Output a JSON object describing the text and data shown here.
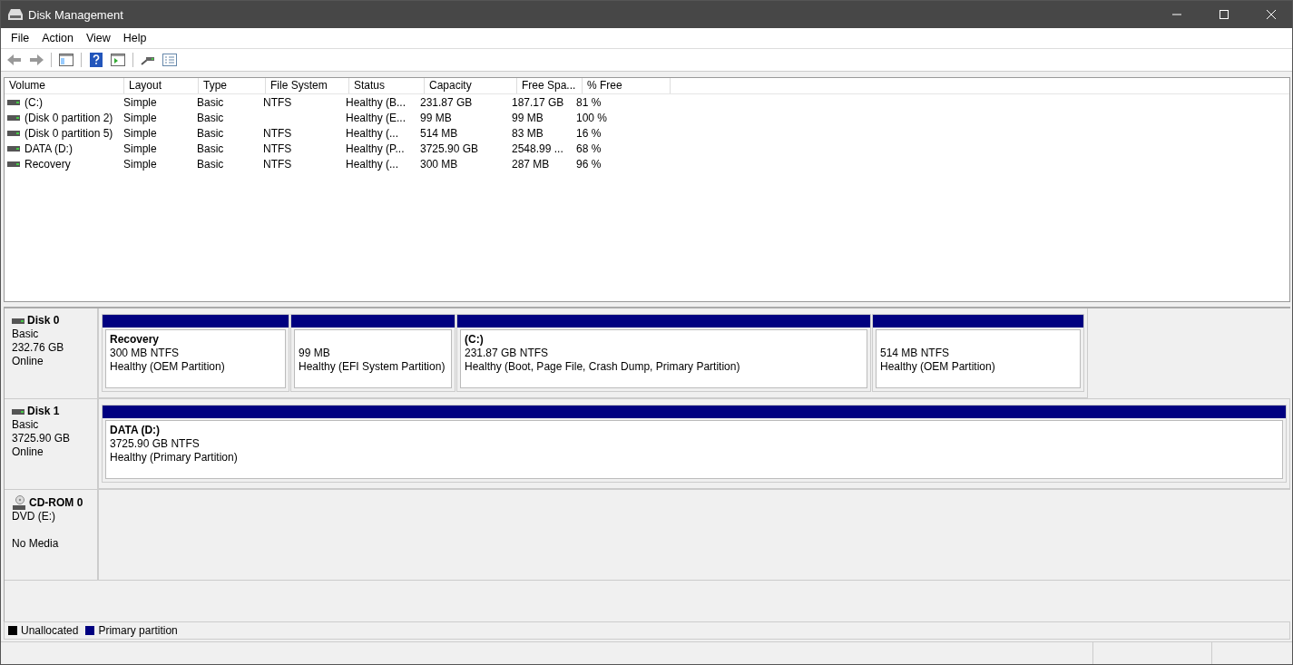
{
  "window": {
    "title": "Disk Management"
  },
  "menu": [
    "File",
    "Action",
    "View",
    "Help"
  ],
  "table": {
    "columns": [
      "Volume",
      "Layout",
      "Type",
      "File System",
      "Status",
      "Capacity",
      "Free Spa...",
      "% Free"
    ],
    "rows": [
      [
        "(C:)",
        "Simple",
        "Basic",
        "NTFS",
        "Healthy (B...",
        "231.87 GB",
        "187.17 GB",
        "81 %"
      ],
      [
        "(Disk 0 partition 2)",
        "Simple",
        "Basic",
        "",
        "Healthy (E...",
        "99 MB",
        "99 MB",
        "100 %"
      ],
      [
        "(Disk 0 partition 5)",
        "Simple",
        "Basic",
        "NTFS",
        "Healthy (...",
        "514 MB",
        "83 MB",
        "16 %"
      ],
      [
        "DATA (D:)",
        "Simple",
        "Basic",
        "NTFS",
        "Healthy (P...",
        "3725.90 GB",
        "2548.99 ...",
        "68 %"
      ],
      [
        "Recovery",
        "Simple",
        "Basic",
        "NTFS",
        "Healthy (...",
        "300 MB",
        "287 MB",
        "96 %"
      ]
    ]
  },
  "disks": [
    {
      "kind": "disk",
      "name": "Disk 0",
      "lines": [
        "Basic",
        "232.76 GB",
        "Online"
      ],
      "partitions": [
        {
          "title": "Recovery",
          "size": "300 MB NTFS",
          "status": "Healthy (OEM Partition)"
        },
        {
          "size": "99 MB",
          "status": "Healthy (EFI System Partition)"
        },
        {
          "title": "(C:)",
          "size": "231.87 GB NTFS",
          "status": "Healthy (Boot, Page File, Crash Dump, Primary Partition)"
        },
        {
          "size": "514 MB NTFS",
          "status": "Healthy (OEM Partition)"
        }
      ]
    },
    {
      "kind": "disk",
      "name": "Disk 1",
      "lines": [
        "Basic",
        "3725.90 GB",
        "Online"
      ],
      "partitions": [
        {
          "title": "DATA  (D:)",
          "size": "3725.90 GB NTFS",
          "status": "Healthy (Primary Partition)"
        }
      ]
    },
    {
      "kind": "cdrom",
      "name": "CD-ROM 0",
      "lines": [
        "DVD (E:)",
        "No Media"
      ]
    }
  ],
  "legend": [
    {
      "label": "Unallocated",
      "color": "#000000"
    },
    {
      "label": "Primary partition",
      "color": "#000080"
    }
  ]
}
